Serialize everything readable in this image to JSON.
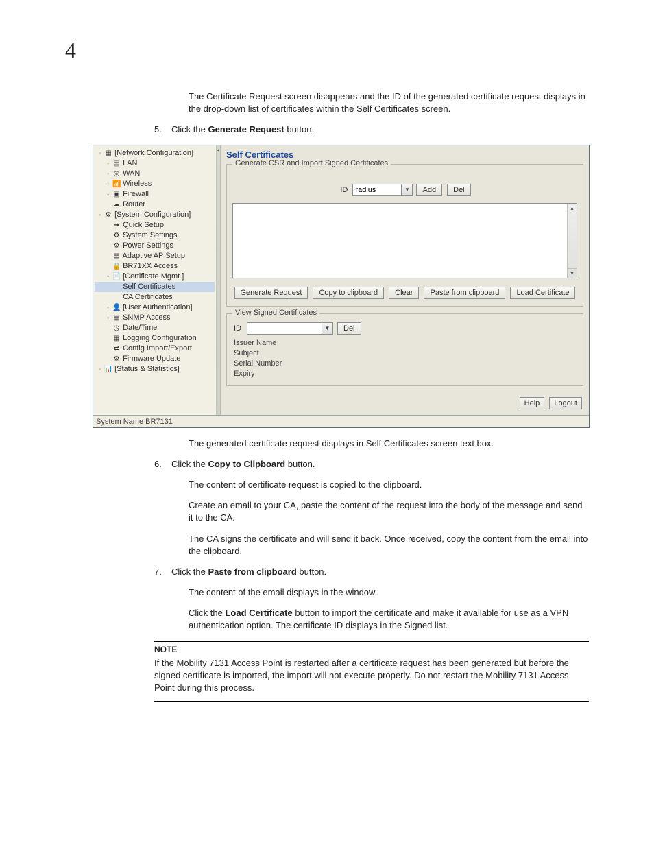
{
  "page": {
    "number": "4",
    "para1": "The Certificate Request screen disappears and the ID of the generated certificate request displays in the drop-down list of certificates within the Self Certificates screen.",
    "para2": "The generated certificate request displays in Self Certificates screen text box.",
    "para3": "The content of certificate request is copied to the clipboard.",
    "para4": "Create an email to your CA, paste the content of the request into the body of the message and send it to the CA.",
    "para5": "The CA signs the certificate and will send it back. Once received, copy the content from the email into the clipboard.",
    "para6": "The content of the email displays in the window.",
    "para7a": "Click the ",
    "para7b": "Load Certificate",
    "para7c": " button to import the certificate and make it available for use as a VPN authentication option. The certificate ID displays in the Signed list."
  },
  "steps": {
    "s5n": "5.",
    "s5a": "Click the ",
    "s5b": "Generate Request",
    "s5c": " button.",
    "s6n": "6.",
    "s6a": "Click the ",
    "s6b": "Copy to Clipboard",
    "s6c": " button.",
    "s7n": "7.",
    "s7a": "Click the ",
    "s7b": "Paste from clipboard",
    "s7c": " button."
  },
  "note": {
    "heading": "NOTE",
    "body": "If the Mobility 7131 Access Point is restarted after a certificate request has been generated but before the signed certificate is imported, the import will not execute properly. Do not restart the Mobility 7131 Access Point during this process."
  },
  "tree": {
    "n0": "[Network Configuration]",
    "n1": "LAN",
    "n2": "WAN",
    "n3": "Wireless",
    "n4": "Firewall",
    "n5": "Router",
    "n6": "[System Configuration]",
    "n7": "Quick Setup",
    "n8": "System Settings",
    "n9": "Power Settings",
    "n10": "Adaptive AP Setup",
    "n11": "BR71XX Access",
    "n12": "[Certificate Mgmt.]",
    "n13": "Self Certificates",
    "n14": "CA Certificates",
    "n15": "[User Authentication]",
    "n16": "SNMP Access",
    "n17": "Date/Time",
    "n18": "Logging Configuration",
    "n19": "Config Import/Export",
    "n20": "Firmware Update",
    "n21": "[Status & Statistics]"
  },
  "ui": {
    "title": "Self Certificates",
    "fieldset1": "Generate CSR and Import Signed Certificates",
    "fieldset2": "View Signed Certificates",
    "idLabel": "ID",
    "idValue": "radius",
    "addBtn": "Add",
    "delBtn": "Del",
    "genBtn": "Generate Request",
    "copyBtn": "Copy to clipboard",
    "clearBtn": "Clear",
    "pasteBtn": "Paste from clipboard",
    "loadBtn": "Load Certificate",
    "id2Label": "ID",
    "id2Value": "",
    "del2Btn": "Del",
    "issuer": "Issuer Name",
    "subject": "Subject",
    "serial": "Serial Number",
    "expiry": "Expiry",
    "helpBtn": "Help",
    "logoutBtn": "Logout",
    "status": "System Name BR7131"
  },
  "chart_data": null
}
